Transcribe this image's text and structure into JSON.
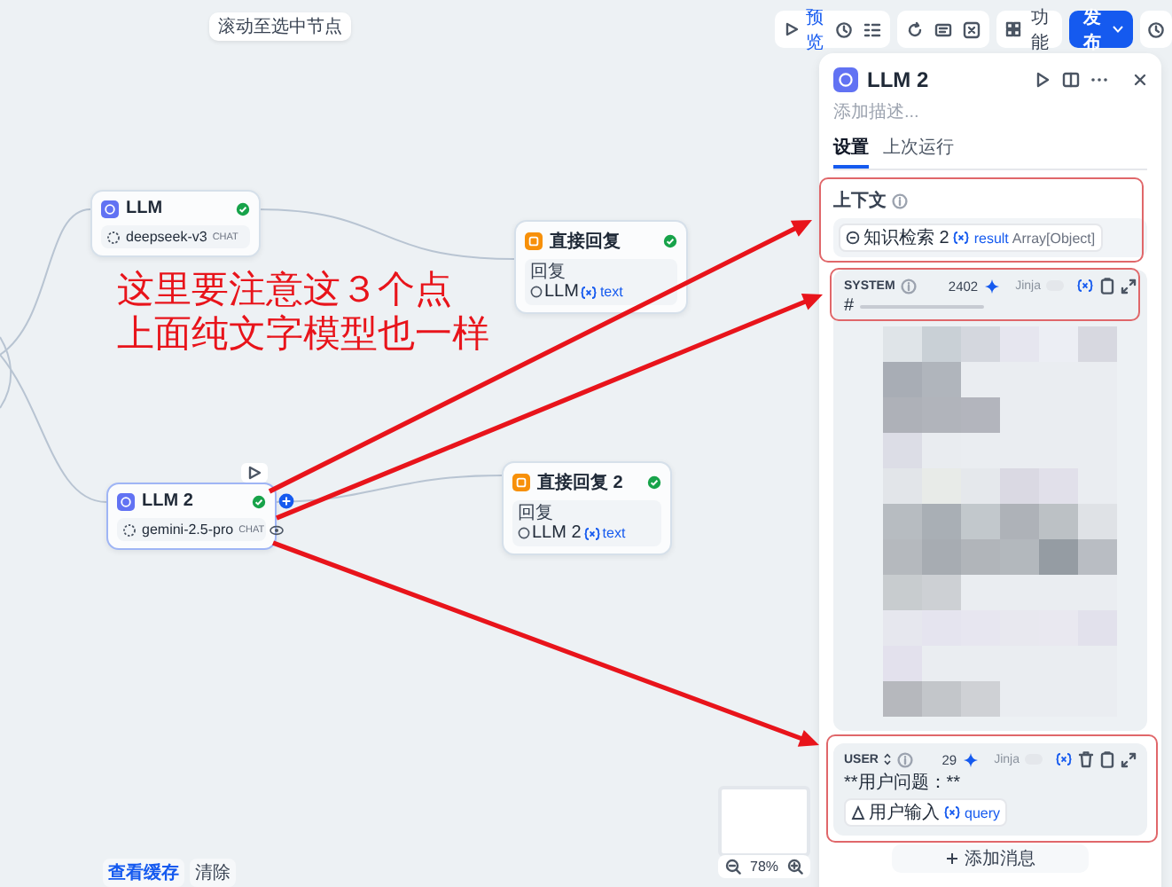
{
  "canvas_hint": "滚动至选中节点",
  "toolbar": {
    "preview": "预览",
    "features": "功能",
    "publish": "发布"
  },
  "nodes": [
    {
      "kind": "llm",
      "title": "LLM",
      "succeeded": true,
      "model": "deepseek-v3",
      "mode": "CHAT",
      "selected": false
    },
    {
      "kind": "answer",
      "title": "直接回复",
      "succeeded": true,
      "field_label": "回复",
      "source": "LLM",
      "variable": "text",
      "selected": false
    },
    {
      "kind": "llm",
      "title": "LLM 2",
      "succeeded": true,
      "model": "gemini-2.5-pro",
      "mode": "CHAT",
      "selected": true
    },
    {
      "kind": "answer",
      "title": "直接回复 2",
      "succeeded": true,
      "field_label": "回复",
      "source": "LLM 2",
      "variable": "text",
      "selected": false
    }
  ],
  "annotation": {
    "lines": [
      "这里要注意这３个点",
      "上面纯文字模型也一样"
    ]
  },
  "bottom_actions": {
    "view_cache": "查看缓存",
    "clear": "清除"
  },
  "zoom": {
    "value": "78%"
  },
  "panel": {
    "title": "LLM 2",
    "description_placeholder": "添加描述...",
    "tabs": [
      {
        "label": "设置",
        "selected": true
      },
      {
        "label": "上次运行",
        "selected": false
      }
    ],
    "context": {
      "label": "上下文",
      "source": "知识检索 2",
      "variable": "result",
      "type": "Array[Object]"
    },
    "messages": [
      {
        "kind": "system",
        "role": "SYSTEM",
        "tokens": "2402",
        "jinja": "Jinja",
        "jinja_on": false,
        "text": "#",
        "redacted": true
      },
      {
        "kind": "user",
        "role": "USER",
        "tokens": "29",
        "jinja": "Jinja",
        "jinja_on": false,
        "text": "**用户问题：**",
        "chip": {
          "source": "用户输入",
          "variable": "query"
        }
      }
    ],
    "add_message": "添加消息"
  }
}
